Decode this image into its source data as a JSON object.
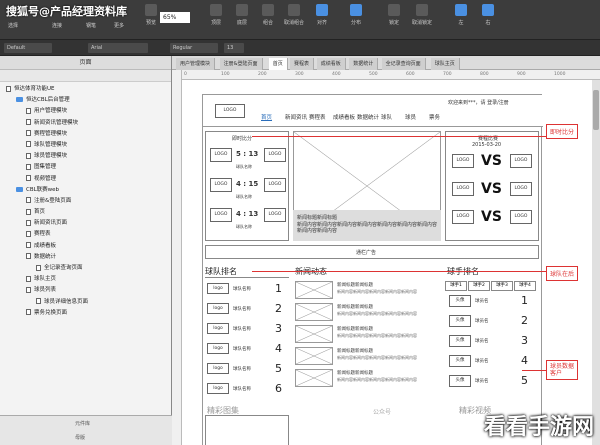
{
  "watermark": "搜狐号@产品经理资料库",
  "toolbar": {
    "select_label": "选择",
    "connect_label": "连接",
    "pen_label": "钢笔",
    "more_label": "更多",
    "zoom": "65%",
    "preview_label": "预览",
    "top_label": "顶层",
    "bottom_label": "底层",
    "group_label": "组合",
    "ungroup_label": "取消组合",
    "align_label": "对齐",
    "distribute_label": "分布",
    "lock_label": "锁定",
    "unlock_label": "取消锁定",
    "left_label": "左",
    "right_label": "右"
  },
  "format_bar": {
    "style": "Default",
    "font": "Arial",
    "weight": "Regular",
    "size": "13"
  },
  "left_panel": {
    "title": "页面",
    "bottom_tab1": "元件库",
    "bottom_tab2": "母版",
    "tree": [
      {
        "label": "恒达体育功能UE",
        "level": 0,
        "kind": "page"
      },
      {
        "label": "恒达CBL后台管理",
        "level": 1,
        "kind": "folder"
      },
      {
        "label": "用户管理模块",
        "level": 2,
        "kind": "page"
      },
      {
        "label": "新闻资讯管理模块",
        "level": 2,
        "kind": "page"
      },
      {
        "label": "赛程管理模块",
        "level": 2,
        "kind": "page"
      },
      {
        "label": "球队管理模块",
        "level": 2,
        "kind": "page"
      },
      {
        "label": "球员管理模块",
        "level": 2,
        "kind": "page"
      },
      {
        "label": "图集管理",
        "level": 2,
        "kind": "page"
      },
      {
        "label": "视频管理",
        "level": 2,
        "kind": "page"
      },
      {
        "label": "CBL联赛web",
        "level": 1,
        "kind": "folder"
      },
      {
        "label": "注册&登陆页面",
        "level": 2,
        "kind": "page"
      },
      {
        "label": "首页",
        "level": 2,
        "kind": "page"
      },
      {
        "label": "新闻资讯页面",
        "level": 2,
        "kind": "page"
      },
      {
        "label": "赛程表",
        "level": 2,
        "kind": "page"
      },
      {
        "label": "成绩看板",
        "level": 2,
        "kind": "page"
      },
      {
        "label": "数据统计",
        "level": 2,
        "kind": "page"
      },
      {
        "label": "全记录查询页面",
        "level": 3,
        "kind": "page"
      },
      {
        "label": "球队主页",
        "level": 2,
        "kind": "page"
      },
      {
        "label": "球员列表",
        "level": 2,
        "kind": "page"
      },
      {
        "label": "球员详细信息页面",
        "level": 3,
        "kind": "page"
      },
      {
        "label": "票务兑换页面",
        "level": 2,
        "kind": "page"
      }
    ]
  },
  "page_tabs": [
    "用户管理模块",
    "注册&登陆页面",
    "首页",
    "赛程表",
    "成绩看板",
    "数据统计",
    "全记录查询页面",
    "球队主页"
  ],
  "ruler": {
    "marks": [
      "0",
      "100",
      "200",
      "300",
      "400",
      "500",
      "600",
      "700",
      "800",
      "900",
      "1000"
    ]
  },
  "wireframe": {
    "logo": "LOGO",
    "welcome": "欢迎来到***，请 登录/注册",
    "nav": [
      "首页",
      "新闻资讯",
      "赛程表",
      "成绩看板",
      "数据统计",
      "球队",
      "球员",
      "票务"
    ],
    "live_score_title": "即时比分",
    "matches": [
      {
        "home": "LOGO",
        "away": "LOGO",
        "score": "5 : 13",
        "label": "球队名称"
      },
      {
        "home": "LOGO",
        "away": "LOGO",
        "score": "4 : 15",
        "label": "球队名称"
      },
      {
        "home": "LOGO",
        "away": "LOGO",
        "score": "4 : 13",
        "label": "球队名称"
      }
    ],
    "headline_title": "新闻标题新闻标题",
    "headline_body": "新闻内容新闻内容新闻内容新闻内容新闻内容新闻内容新闻内容新闻内容新闻内容",
    "schedule_title": "赛程比赛",
    "schedule_date": "2015-03-20",
    "vs": "VS",
    "ad": "通栏广告",
    "team_rank_title": "球队排名",
    "team_rank": [
      {
        "logo": "logo",
        "name": "球队名称",
        "rank": "1"
      },
      {
        "logo": "logo",
        "name": "球队名称",
        "rank": "2"
      },
      {
        "logo": "logo",
        "name": "球队名称",
        "rank": "3"
      },
      {
        "logo": "logo",
        "name": "球队名称",
        "rank": "4"
      },
      {
        "logo": "logo",
        "name": "球队名称",
        "rank": "5"
      },
      {
        "logo": "logo",
        "name": "球队名称",
        "rank": "6"
      }
    ],
    "news_title": "新闻动态",
    "news_items": [
      {
        "title": "新闻标题新闻标题",
        "body": "新闻内容新闻内容新闻内容新闻内容新闻内容"
      },
      {
        "title": "新闻标题新闻标题",
        "body": "新闻内容新闻内容新闻内容新闻内容新闻内容"
      },
      {
        "title": "新闻标题新闻标题",
        "body": "新闻内容新闻内容新闻内容新闻内容新闻内容"
      },
      {
        "title": "新闻标题新闻标题",
        "body": "新闻内容新闻内容新闻内容新闻内容新闻内容"
      },
      {
        "title": "新闻标题新闻标题",
        "body": "新闻内容新闻内容新闻内容新闻内容新闻内容"
      }
    ],
    "player_rank_title": "球手排名",
    "player_tabs": [
      "球手1",
      "球手2",
      "球手3",
      "球手4"
    ],
    "player_rank": [
      {
        "avatar": "头像",
        "name": "球员名",
        "rank": "1"
      },
      {
        "avatar": "头像",
        "name": "球员名",
        "rank": "2"
      },
      {
        "avatar": "头像",
        "name": "球员名",
        "rank": "3"
      },
      {
        "avatar": "头像",
        "name": "球员名",
        "rank": "4"
      },
      {
        "avatar": "头像",
        "name": "球员名",
        "rank": "5"
      }
    ],
    "gallery_title": "精彩图集",
    "video_title": "精彩视频"
  },
  "annotations": {
    "live_score": "即时比分",
    "team_rank": "球队在后",
    "player_data": "球员数据\n客户"
  },
  "brand_watermark": "公众号",
  "brand": "看看手游网"
}
